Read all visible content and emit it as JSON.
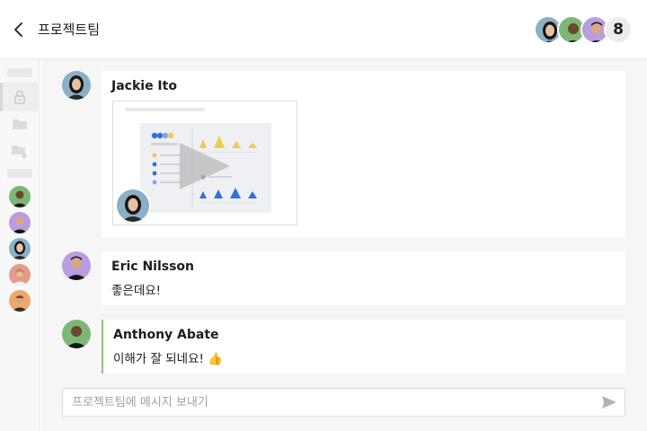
{
  "header": {
    "title": "프로젝트팀",
    "member_count": "8"
  },
  "messages": [
    {
      "author": "Jackie Ito",
      "attachment": "video"
    },
    {
      "author": "Eric Nilsson",
      "text": "좋은데요!"
    },
    {
      "author": "Anthony Abate",
      "text": "이해가 잘 되네요! 👍"
    }
  ],
  "composer": {
    "placeholder": "프로젝트팀에 메시지 보내기"
  },
  "colors": {
    "highlight": "#8ec47d",
    "chart_yellow": "#f2c94c",
    "chart_blue": "#2f6fe0"
  }
}
